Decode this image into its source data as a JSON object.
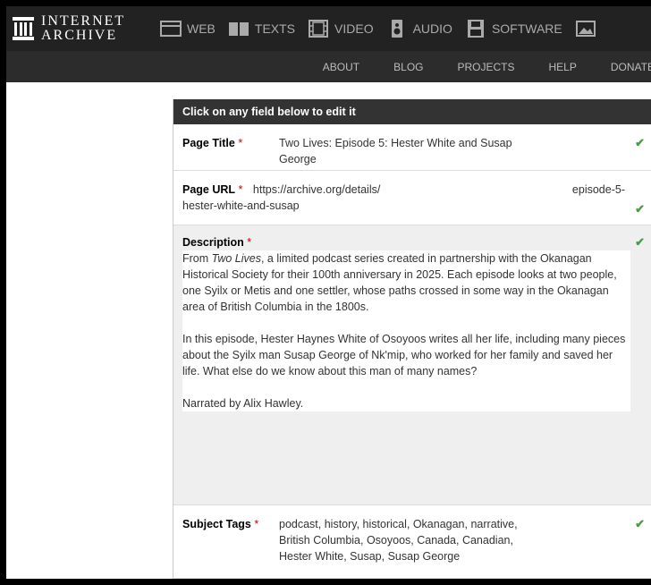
{
  "logo": {
    "line1": "INTERNET",
    "line2": "ARCHIVE"
  },
  "nav": {
    "web": "WEB",
    "texts": "TEXTS",
    "video": "VIDEO",
    "audio": "AUDIO",
    "software": "SOFTWARE"
  },
  "subnav": {
    "about": "ABOUT",
    "blog": "BLOG",
    "projects": "PROJECTS",
    "help": "HELP",
    "donate": "DONATE"
  },
  "panel": {
    "header": "Click on any field below to edit it",
    "title": {
      "label": "Page Title",
      "required": "*",
      "value_line1": "Two Lives: Episode 5: Hester White and Susap",
      "value_line2": "George"
    },
    "url": {
      "label": "Page URL",
      "required": "*",
      "prefix": "https://archive.org/details/",
      "slug_part1": "episode-5-",
      "slug_part2": "hester-white-and-susap"
    },
    "description": {
      "label": "Description",
      "required": "*",
      "p1_italic": "Two Lives",
      "p1_before": "From ",
      "p1_after": ", a limited podcast series created in partnership with the Okanagan Historical Society for their 100th anniversary in 2025. Each episode looks at two people, one Syilx or Metis and one settler, whose paths crossed in some way in the Okanagan area of British Columbia in the 1800s.",
      "p2": "In this episode, Hester Haynes White of Osoyoos writes all her life, including many pieces about the Syilx man Susap George of Nk'mip, who worked for her family and saved her life. What else do we know about this man of many names?",
      "p3": "Narrated by Alix Hawley."
    },
    "tags": {
      "label": "Subject Tags",
      "required": "*",
      "line1": "podcast, history, historical, Okanagan, narrative,",
      "line2": "British Columbia, Osoyoos, Canada, Canadian,",
      "line3": "Hester White, Susap, Susap George"
    },
    "check_glyph": "✔"
  }
}
